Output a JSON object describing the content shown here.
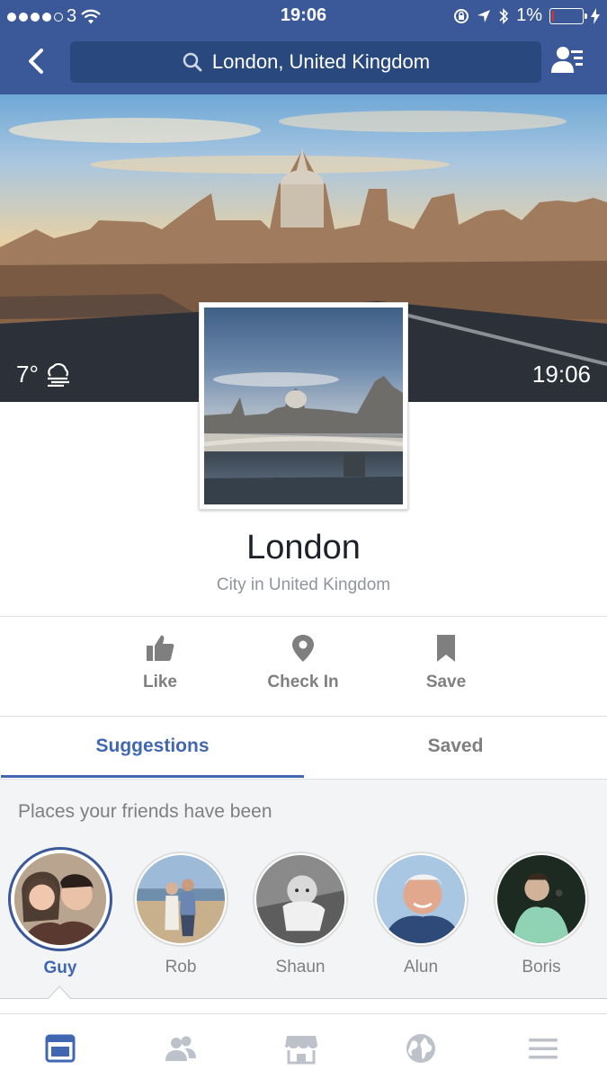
{
  "status_bar": {
    "carrier": "3",
    "time": "19:06",
    "battery": "1%",
    "battery_level": 0.01
  },
  "search": {
    "query": "London, United Kingdom"
  },
  "cover": {
    "temperature": "7°",
    "local_time": "19:06"
  },
  "page": {
    "title": "London",
    "subtitle": "City in United Kingdom"
  },
  "actions": [
    {
      "label": "Like",
      "icon": "thumbs-up-icon"
    },
    {
      "label": "Check In",
      "icon": "map-pin-icon"
    },
    {
      "label": "Save",
      "icon": "bookmark-icon"
    }
  ],
  "tabs": [
    {
      "label": "Suggestions",
      "active": true
    },
    {
      "label": "Saved",
      "active": false
    }
  ],
  "friends_section": {
    "title": "Places your friends have been",
    "friends": [
      {
        "name": "Guy",
        "selected": true
      },
      {
        "name": "Rob",
        "selected": false
      },
      {
        "name": "Shaun",
        "selected": false
      },
      {
        "name": "Alun",
        "selected": false
      },
      {
        "name": "Boris",
        "selected": false
      }
    ]
  },
  "bottom_nav": [
    {
      "icon": "news-feed-icon",
      "active": true
    },
    {
      "icon": "friends-icon",
      "active": false
    },
    {
      "icon": "marketplace-icon",
      "active": false
    },
    {
      "icon": "globe-icon",
      "active": false
    },
    {
      "icon": "menu-icon",
      "active": false
    }
  ],
  "colors": {
    "brand": "#3b5998",
    "accent": "#4267b2",
    "battery_low": "#e0302e"
  }
}
